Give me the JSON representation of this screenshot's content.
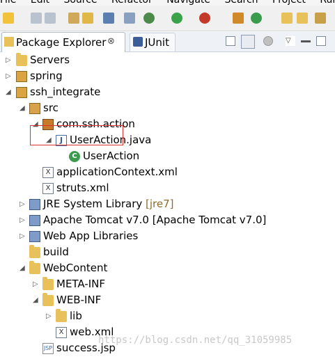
{
  "menu": {
    "items": [
      "File",
      "Edit",
      "Source",
      "Refactor",
      "Navigate",
      "Search",
      "Project",
      "Run"
    ]
  },
  "tabs": {
    "package_explorer": "Package Explorer",
    "junit": "JUnit",
    "close_glyph": "⊗"
  },
  "tree": {
    "rows": [
      {
        "label": "Servers",
        "arrow": "▷",
        "icon": "folder-icon"
      },
      {
        "label": "spring",
        "arrow": "▷",
        "icon": "project-icon"
      },
      {
        "label": "ssh_integrate",
        "arrow": "◢",
        "icon": "project-icon"
      },
      {
        "label": "src",
        "arrow": "◢",
        "icon": "source-folder-icon"
      },
      {
        "label": "com.ssh.action",
        "arrow": "◢",
        "icon": "package-icon"
      },
      {
        "label": "UserAction.java",
        "arrow": "◢",
        "icon": "java-file-icon"
      },
      {
        "label": "UserAction",
        "arrow": "",
        "icon": "class-icon"
      },
      {
        "label": "applicationContext.xml",
        "arrow": "",
        "icon": "xml-file-icon"
      },
      {
        "label": "struts.xml",
        "arrow": "",
        "icon": "xml-file-icon"
      },
      {
        "label": "JRE System Library",
        "decoration": "[jre7]",
        "arrow": "▷",
        "icon": "library-icon"
      },
      {
        "label": "Apache Tomcat v7.0 [Apache Tomcat v7.0]",
        "arrow": "▷",
        "icon": "library-icon"
      },
      {
        "label": "Web App Libraries",
        "arrow": "▷",
        "icon": "library-icon"
      },
      {
        "label": "build",
        "arrow": "",
        "icon": "folder-icon"
      },
      {
        "label": "WebContent",
        "arrow": "◢",
        "icon": "folder-icon"
      },
      {
        "label": "META-INF",
        "arrow": "▷",
        "icon": "folder-icon"
      },
      {
        "label": "WEB-INF",
        "arrow": "◢",
        "icon": "folder-icon"
      },
      {
        "label": "lib",
        "arrow": "▷",
        "icon": "folder-icon"
      },
      {
        "label": "web.xml",
        "arrow": "",
        "icon": "xml-file-icon"
      },
      {
        "label": "success.jsp",
        "arrow": "",
        "icon": "jsp-file-icon"
      }
    ]
  },
  "watermark": "https://blog.csdn.net/qq_31059985"
}
